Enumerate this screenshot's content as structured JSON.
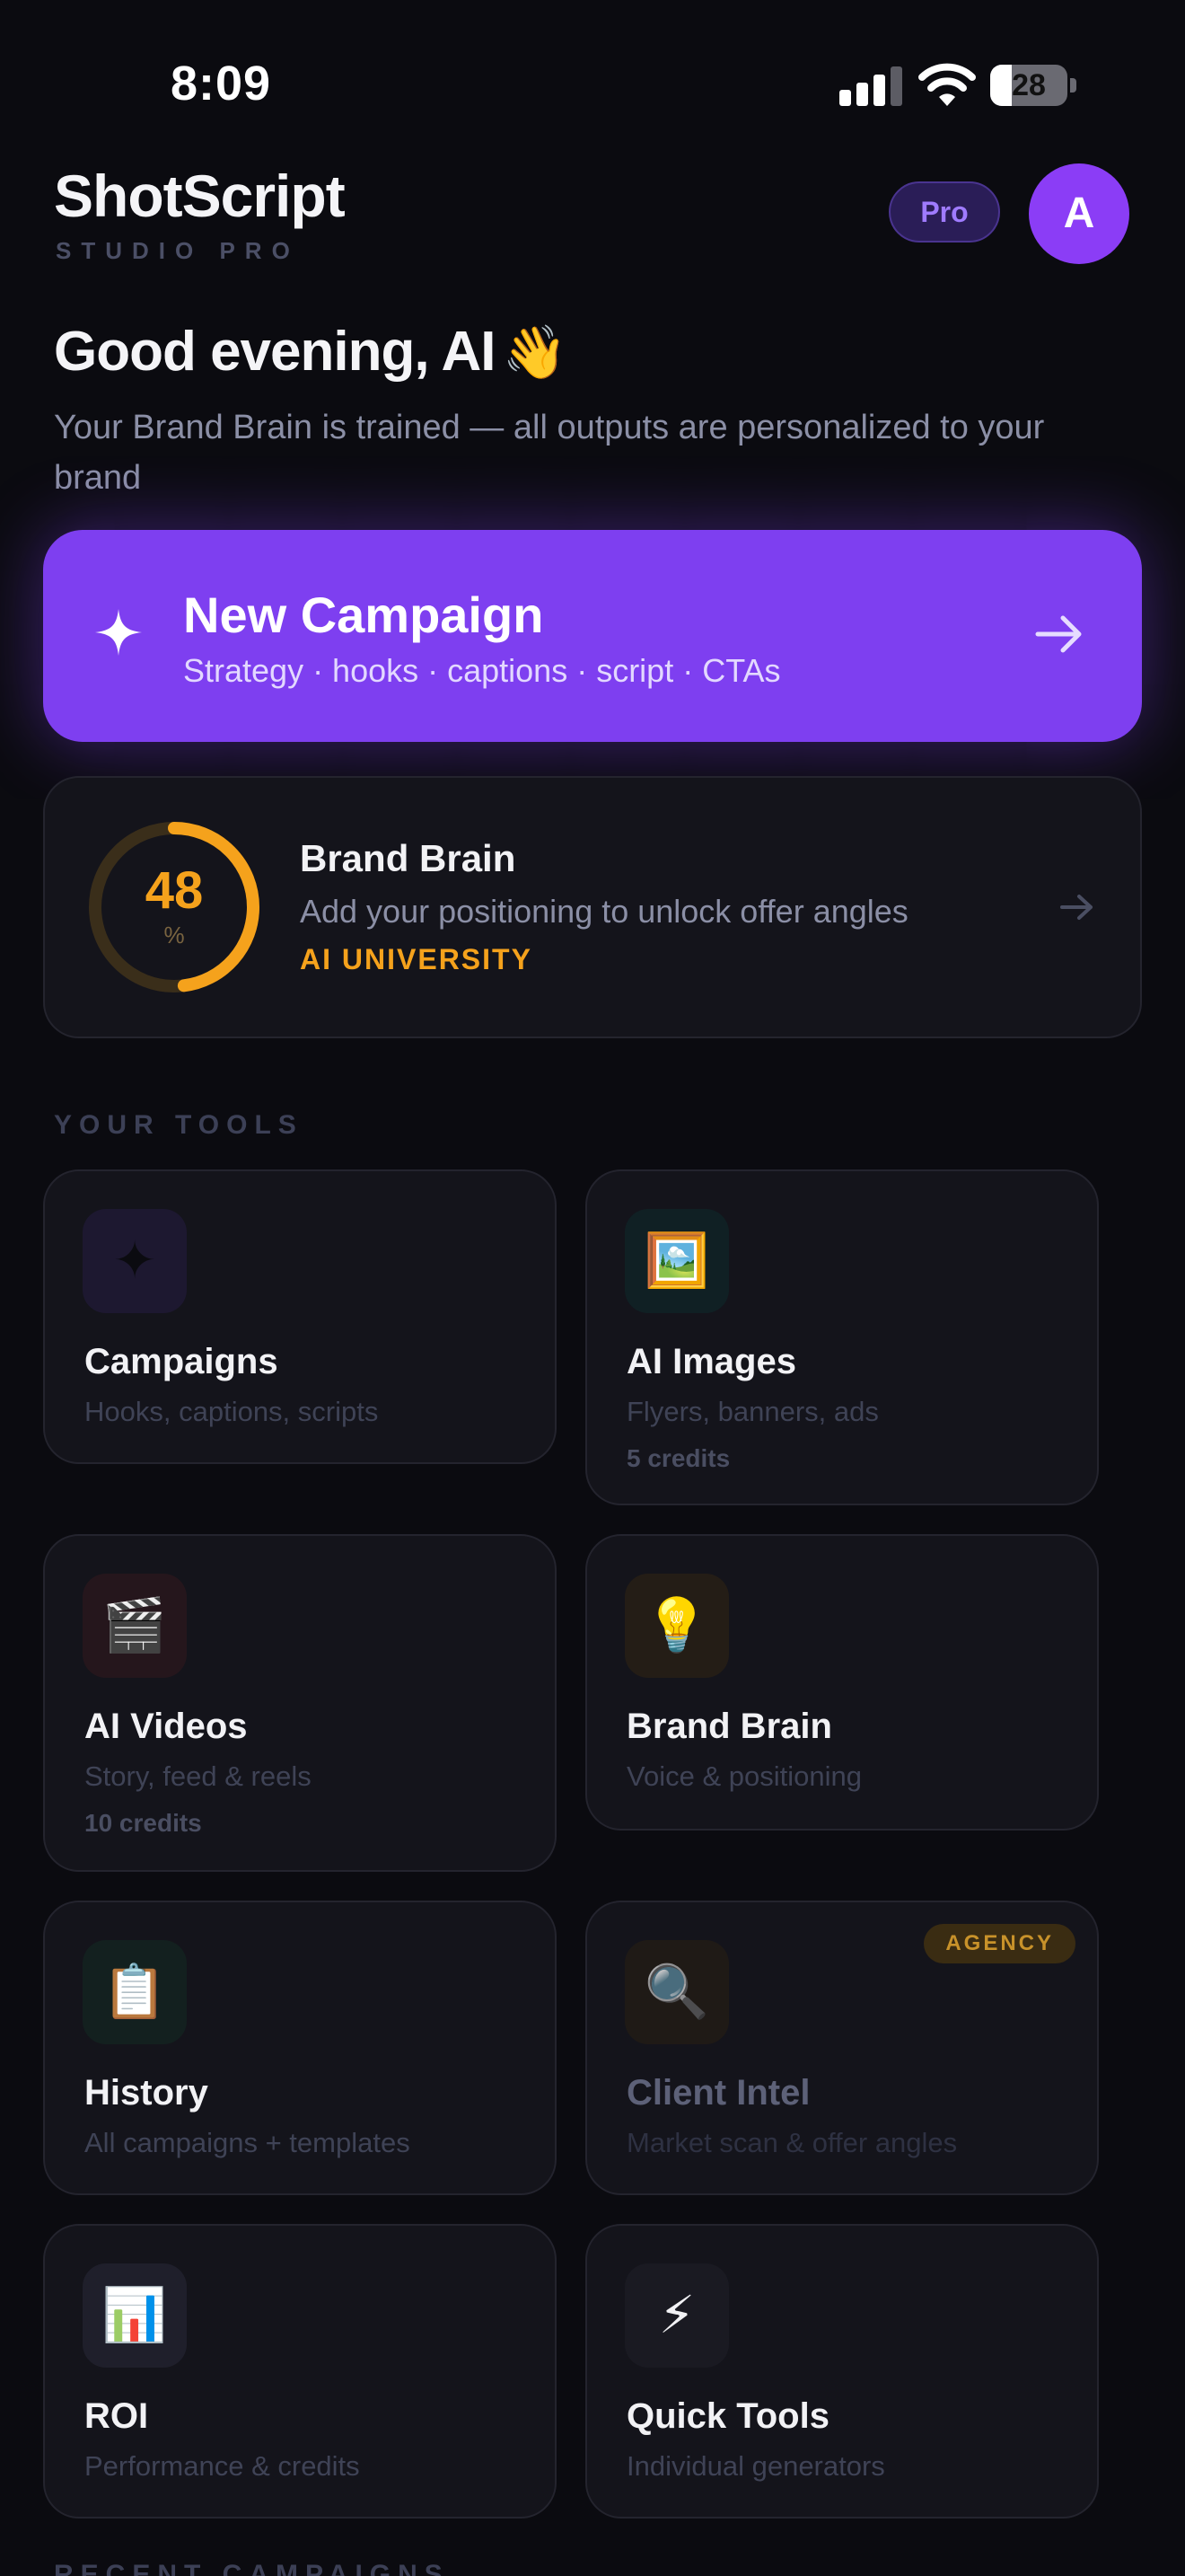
{
  "status_bar": {
    "time": "8:09",
    "battery": "28",
    "battery_level": 0.28
  },
  "header": {
    "app_name": "ShotScript",
    "app_subtitle": "STUDIO PRO",
    "pro_badge": "Pro",
    "avatar_initial": "A"
  },
  "greeting": {
    "title": "Good evening, AI",
    "emoji": "👋",
    "subtitle": "Your Brand Brain is trained — all outputs are personalized to your brand"
  },
  "cta": {
    "title": "New Campaign",
    "subtitle": "Strategy · hooks · captions · script · CTAs",
    "icon": "sparkle-icon"
  },
  "brand_brain": {
    "score": "48",
    "score_fraction": 0.48,
    "unit": "%",
    "title": "Brand Brain",
    "description": "Add your positioning to unlock offer angles",
    "tag": "AI UNIVERSITY",
    "accent": "#f5a21c"
  },
  "tools_section_label": "YOUR TOOLS",
  "tools": [
    {
      "title": "Campaigns",
      "description": "Hooks, captions, scripts",
      "icon": "✦",
      "icon_name": "sparkle-icon",
      "icon_bg": "#1d1830"
    },
    {
      "title": "AI Images",
      "description": "Flyers, banners, ads",
      "credits": "5 credits",
      "icon": "🖼️",
      "icon_name": "framed-picture-icon",
      "icon_bg": "#102024"
    },
    {
      "title": "AI Videos",
      "description": "Story, feed & reels",
      "credits": "10 credits",
      "icon": "🎬",
      "icon_name": "clapper-board-icon",
      "icon_bg": "#25161c"
    },
    {
      "title": "Brand Brain",
      "description": "Voice & positioning",
      "icon": "💡",
      "icon_name": "light-bulb-icon",
      "icon_bg": "#241d16"
    },
    {
      "title": "History",
      "description": "All campaigns + templates",
      "icon": "📋",
      "icon_name": "clipboard-icon",
      "icon_bg": "#13201f"
    },
    {
      "title": "Client Intel",
      "description": "Market scan & offer angles",
      "icon": "🔍",
      "icon_name": "magnifier-icon",
      "icon_bg": "#231d15",
      "badge": "AGENCY"
    },
    {
      "title": "ROI",
      "description": "Performance & credits",
      "icon": "📊",
      "icon_name": "bar-chart-icon",
      "icon_bg": "#1f1f2b"
    },
    {
      "title": "Quick Tools",
      "description": "Individual generators",
      "icon": "⚡",
      "icon_name": "lightning-icon",
      "icon_bg": "#1a1a22"
    }
  ],
  "recent_section_label": "RECENT CAMPAIGNS"
}
